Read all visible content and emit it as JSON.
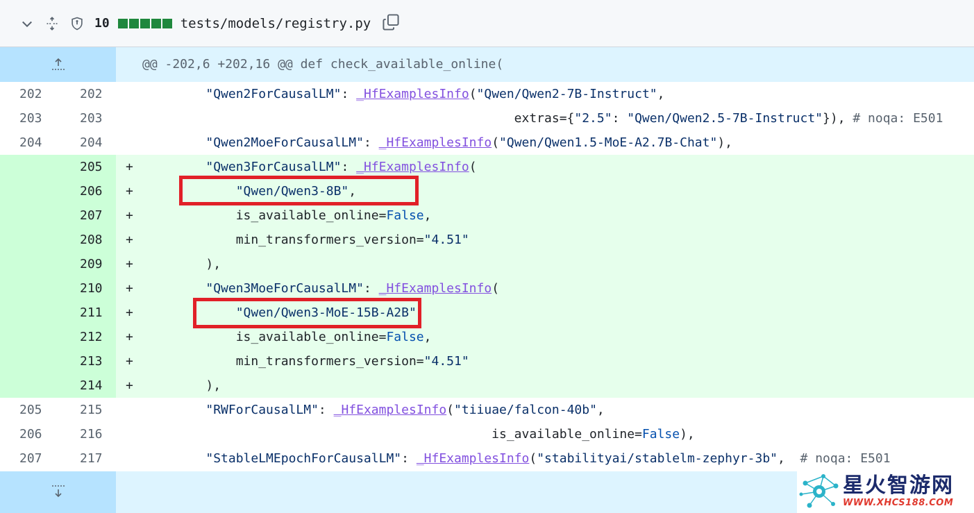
{
  "file": {
    "changes_count": "10",
    "filename": "tests/models/registry.py",
    "diffstat_colors": [
      "#1f883d",
      "#1f883d",
      "#1f883d",
      "#1f883d",
      "#1f883d"
    ]
  },
  "hunk": {
    "header": "@@ -202,6 +202,16 @@ def check_available_online("
  },
  "lines": [
    {
      "old": "202",
      "new": "202",
      "type": "context",
      "marker": ""
    },
    {
      "old": "203",
      "new": "203",
      "type": "context",
      "marker": ""
    },
    {
      "old": "204",
      "new": "204",
      "type": "context",
      "marker": ""
    },
    {
      "old": "",
      "new": "205",
      "type": "add",
      "marker": "+"
    },
    {
      "old": "",
      "new": "206",
      "type": "add",
      "marker": "+"
    },
    {
      "old": "",
      "new": "207",
      "type": "add",
      "marker": "+"
    },
    {
      "old": "",
      "new": "208",
      "type": "add",
      "marker": "+"
    },
    {
      "old": "",
      "new": "209",
      "type": "add",
      "marker": "+"
    },
    {
      "old": "",
      "new": "210",
      "type": "add",
      "marker": "+"
    },
    {
      "old": "",
      "new": "211",
      "type": "add",
      "marker": "+"
    },
    {
      "old": "",
      "new": "212",
      "type": "add",
      "marker": "+"
    },
    {
      "old": "",
      "new": "213",
      "type": "add",
      "marker": "+"
    },
    {
      "old": "",
      "new": "214",
      "type": "add",
      "marker": "+"
    },
    {
      "old": "205",
      "new": "215",
      "type": "context",
      "marker": ""
    },
    {
      "old": "206",
      "new": "216",
      "type": "context",
      "marker": ""
    },
    {
      "old": "207",
      "new": "217",
      "type": "context",
      "marker": ""
    }
  ],
  "code": {
    "l202": {
      "s1": "\"Qwen2ForCausalLM\"",
      "p1": ": ",
      "f1": "_HfExamplesInfo",
      "p2": "(",
      "s2": "\"Qwen/Qwen2-7B-Instruct\"",
      "p3": ","
    },
    "l203": {
      "p1": "extras={",
      "s1": "\"2.5\"",
      "p2": ": ",
      "s2": "\"Qwen/Qwen2.5-7B-Instruct\"",
      "p3": "}), ",
      "c1": "# noqa: E501"
    },
    "l204": {
      "s1": "\"Qwen2MoeForCausalLM\"",
      "p1": ": ",
      "f1": "_HfExamplesInfo",
      "p2": "(",
      "s2": "\"Qwen/Qwen1.5-MoE-A2.7B-Chat\"",
      "p3": "),"
    },
    "l205": {
      "s1": "\"Qwen3ForCausalLM\"",
      "p1": ": ",
      "f1": "_HfExamplesInfo",
      "p2": "("
    },
    "l206": {
      "s1": "\"Qwen/Qwen3-8B\"",
      "p1": ","
    },
    "l207": {
      "p1": "is_available_online=",
      "k1": "False",
      "p2": ","
    },
    "l208": {
      "p1": "min_transformers_version=",
      "s1": "\"4.51\""
    },
    "l209": {
      "p1": "),"
    },
    "l210": {
      "s1": "\"Qwen3MoeForCausalLM\"",
      "p1": ": ",
      "f1": "_HfExamplesInfo",
      "p2": "("
    },
    "l211": {
      "s1": "\"Qwen/Qwen3-MoE-15B-A2B\"",
      "p1": ","
    },
    "l212": {
      "p1": "is_available_online=",
      "k1": "False",
      "p2": ","
    },
    "l213": {
      "p1": "min_transformers_version=",
      "s1": "\"4.51\""
    },
    "l214": {
      "p1": "),"
    },
    "l215": {
      "s1": "\"RWForCausalLM\"",
      "p1": ": ",
      "f1": "_HfExamplesInfo",
      "p2": "(",
      "s2": "\"tiiuae/falcon-40b\"",
      "p3": ","
    },
    "l216": {
      "p1": "is_available_online=",
      "k1": "False",
      "p2": "),"
    },
    "l217": {
      "s1": "\"StableLMEpochForCausalLM\"",
      "p1": ": ",
      "f1": "_HfExamplesInfo",
      "p2": "(",
      "s2": "\"stabilityai/stablelm-zephyr-3b\"",
      "p3": ",  ",
      "c1": "# noqa: E501"
    }
  },
  "watermark": {
    "name_cn": "星火智游网",
    "url": "WWW.XHCS188.COM"
  },
  "colors": {
    "highlight_box": "#e12028",
    "addition_bg": "#e6ffec",
    "addition_gutter": "#ccffd8",
    "hunk_bg": "#ddf4ff",
    "hunk_gutter": "#b6e3ff"
  },
  "icons": {
    "collapse": "chevron-down-icon",
    "expand_all": "unfold-icon",
    "shield": "shield-lock-icon",
    "copy": "copy-icon",
    "expand_up": "expand-up-icon",
    "expand_down": "expand-down-icon"
  }
}
